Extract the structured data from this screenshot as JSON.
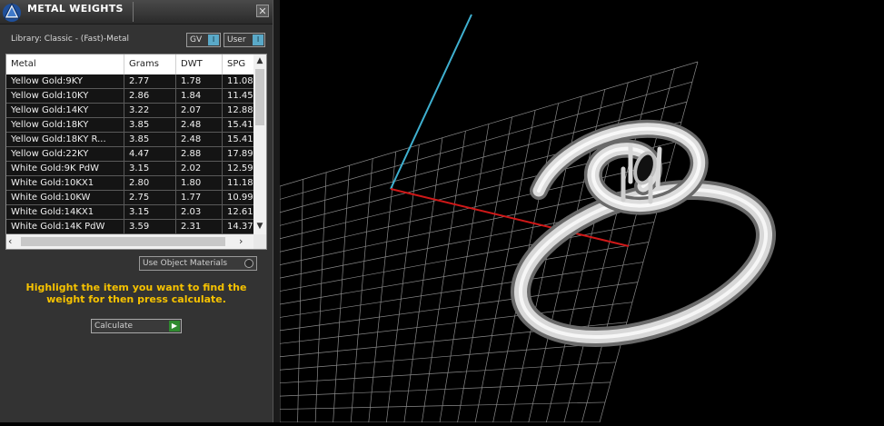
{
  "panel": {
    "title": "METAL WEIGHTS",
    "close_glyph": "✕",
    "library_label": "Library: Classic - (Fast)-Metal",
    "toggles": [
      {
        "label": "GV",
        "knob": "I"
      },
      {
        "label": "User",
        "knob": "I"
      }
    ],
    "table": {
      "headers": [
        "Metal",
        "Grams",
        "DWT",
        "SPG"
      ],
      "rows": [
        [
          "Yellow Gold:9KY",
          "2.77",
          "1.78",
          "11.08"
        ],
        [
          "Yellow Gold:10KY",
          "2.86",
          "1.84",
          "11.45"
        ],
        [
          "Yellow Gold:14KY",
          "3.22",
          "2.07",
          "12.88"
        ],
        [
          "Yellow Gold:18KY",
          "3.85",
          "2.48",
          "15.41"
        ],
        [
          "Yellow Gold:18KY R...",
          "3.85",
          "2.48",
          "15.41"
        ],
        [
          "Yellow Gold:22KY",
          "4.47",
          "2.88",
          "17.89"
        ],
        [
          "White Gold:9K PdW",
          "3.15",
          "2.02",
          "12.59"
        ],
        [
          "White Gold:10KX1",
          "2.80",
          "1.80",
          "11.18"
        ],
        [
          "White Gold:10KW",
          "2.75",
          "1.77",
          "10.99"
        ],
        [
          "White Gold:14KX1",
          "3.15",
          "2.03",
          "12.61"
        ],
        [
          "White Gold:14K PdW",
          "3.59",
          "2.31",
          "14.37"
        ]
      ]
    },
    "use_object_materials_label": "Use Object Materials",
    "instructions": "Highlight the item you want to find the weight for then press calculate.",
    "calculate_label": "Calculate",
    "colors": {
      "panel_bg": "#333333",
      "instructions_text": "#f6c200",
      "toggle_knob": "#5aa9c8",
      "calculate_go": "#2f8a2f"
    }
  },
  "viewport": {
    "grid_color": "#8a8a8a",
    "axis_x_color": "#d01818",
    "axis_y_color": "#3fb0d0",
    "model": "ring"
  }
}
